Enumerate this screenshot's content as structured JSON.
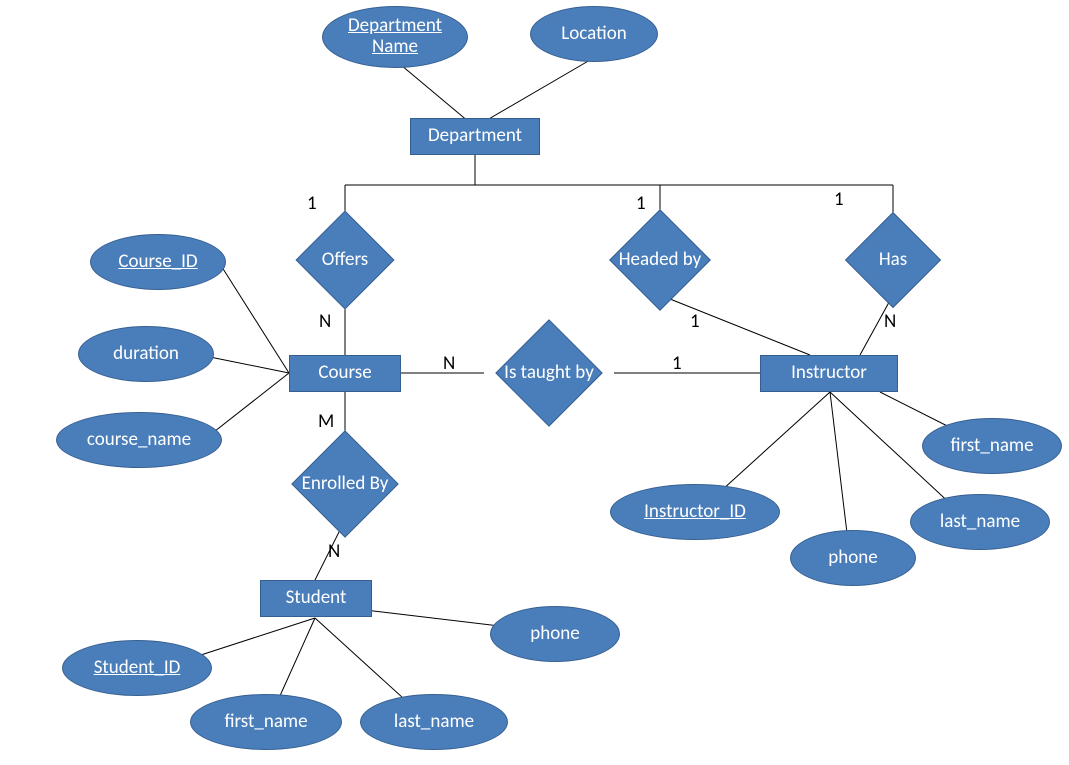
{
  "entities": {
    "department": "Department",
    "course": "Course",
    "instructor": "Instructor",
    "student": "Student"
  },
  "relationships": {
    "offers": "Offers",
    "headed_by": "Headed by",
    "has": "Has",
    "is_taught_by": "Is taught by",
    "enrolled_by": "Enrolled By"
  },
  "attributes": {
    "department_name": "Department Name",
    "location": "Location",
    "course_id": "Course_ID",
    "duration": "duration",
    "course_name": "course_name",
    "instructor_id": "Instructor_ID",
    "inst_first_name": "first_name",
    "inst_last_name": "last_name",
    "inst_phone": "phone",
    "student_id": "Student_ID",
    "stu_first_name": "first_name",
    "stu_last_name": "last_name",
    "stu_phone": "phone"
  },
  "cardinalities": {
    "dep_offers": "1",
    "offers_course": "N",
    "dep_headed": "1",
    "headed_inst": "1",
    "dep_has": "1",
    "has_inst": "N",
    "course_taught": "N",
    "taught_inst": "1",
    "course_enrolled": "M",
    "enrolled_student": "N"
  }
}
